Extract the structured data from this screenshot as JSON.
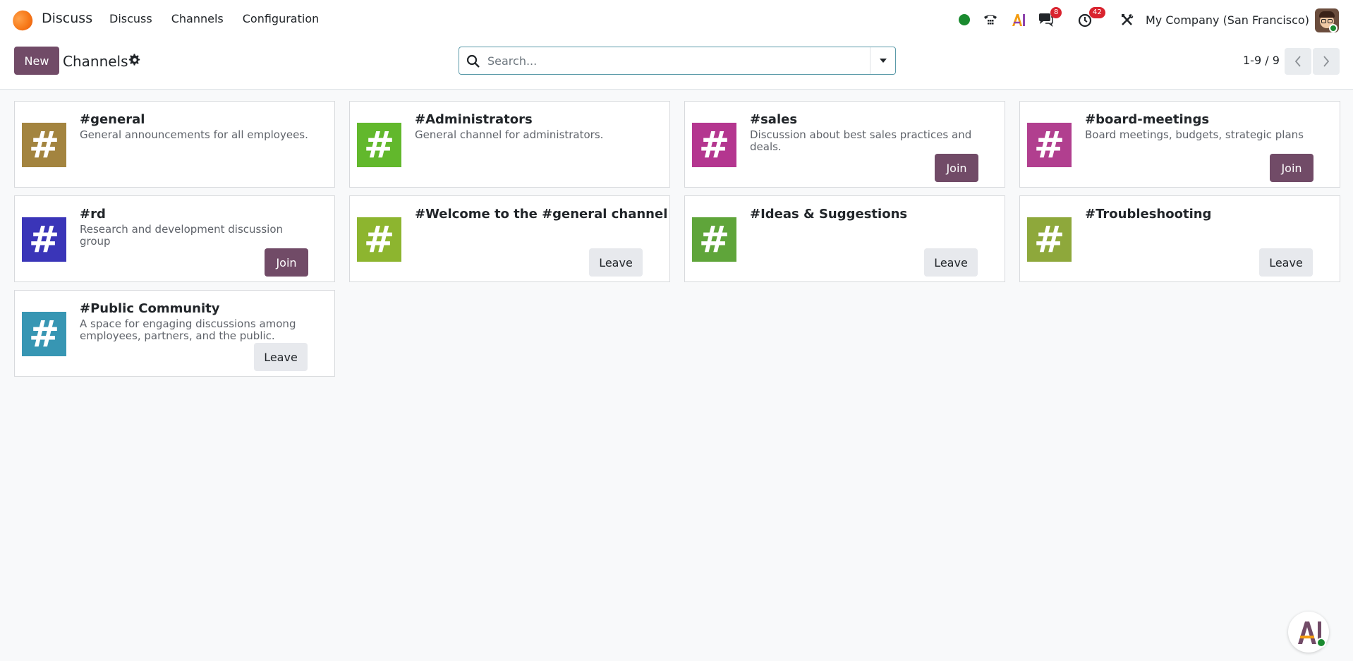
{
  "navbar": {
    "app_name": "Discuss",
    "menu": [
      "Discuss",
      "Channels",
      "Configuration"
    ],
    "messages_count": "8",
    "activities_count": "42",
    "company": "My Company (San Francisco)"
  },
  "control_panel": {
    "new_label": "New",
    "title": "Channels",
    "search_placeholder": "Search...",
    "pager": "1-9 / 9"
  },
  "channels": [
    {
      "name": "#general",
      "description": "General announcements for all employees.",
      "color": "#a3843f",
      "action": ""
    },
    {
      "name": "#Administrators",
      "description": "General channel for administrators.",
      "color": "#62b82c",
      "action": ""
    },
    {
      "name": "#sales",
      "description": "Discussion about best sales practices and deals.",
      "color": "#b4368f",
      "action": "Join"
    },
    {
      "name": "#board-meetings",
      "description": "Board meetings, budgets, strategic plans",
      "color": "#b13f8f",
      "action": "Join"
    },
    {
      "name": "#rd",
      "description": "Research and development discussion group",
      "color": "#3a35b8",
      "action": "Join"
    },
    {
      "name": "#Welcome to the #general channel",
      "description": "",
      "color": "#8db52f",
      "action": "Leave"
    },
    {
      "name": "#Ideas & Suggestions",
      "description": "",
      "color": "#5fa53a",
      "action": "Leave"
    },
    {
      "name": "#Troubleshooting",
      "description": "",
      "color": "#8ea83b",
      "action": "Leave"
    },
    {
      "name": "#Public Community",
      "description": "A space for engaging discussions among employees, partners, and the public.",
      "color": "#3796b3",
      "action": "Leave"
    }
  ],
  "colors": {
    "brand_primary": "#714b67",
    "online": "#1a8a2f",
    "badge": "#d9232e"
  }
}
